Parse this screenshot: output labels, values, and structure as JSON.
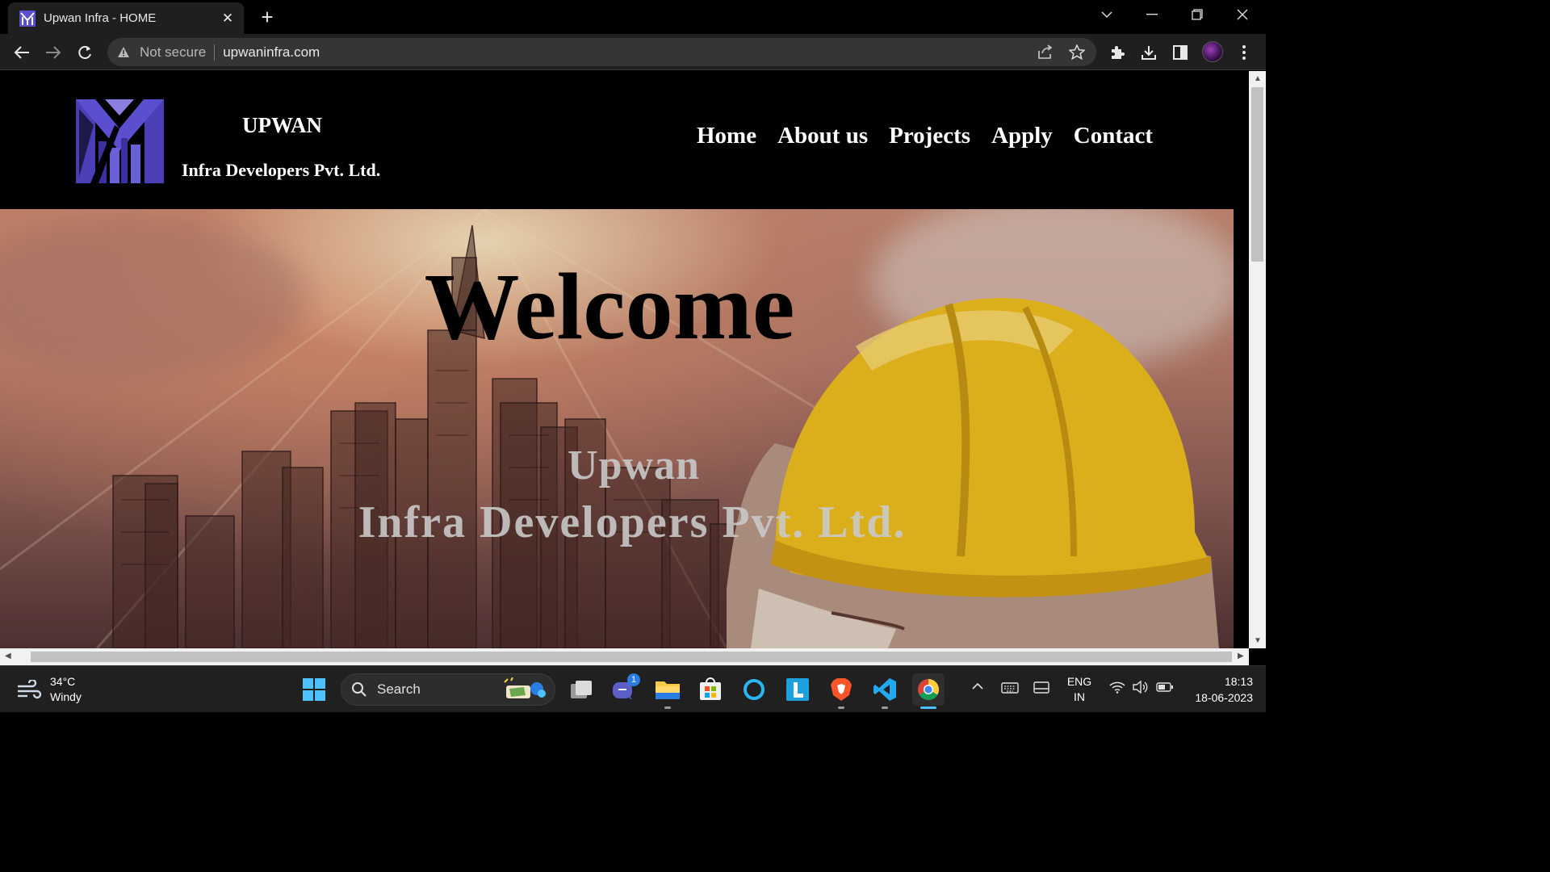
{
  "browser": {
    "tab_title": "Upwan Infra - HOME",
    "security_label": "Not secure",
    "url": "upwaninfra.com"
  },
  "site": {
    "brand_name": "UPWAN",
    "brand_subtitle": "Infra Developers Pvt. Ltd.",
    "nav": [
      "Home",
      "About us",
      "Projects",
      "Apply",
      "Contact"
    ],
    "hero": {
      "heading": "Welcome",
      "line1": "Upwan",
      "line2": "Infra Developers Pvt. Ltd."
    }
  },
  "taskbar": {
    "weather_temp": "34°C",
    "weather_desc": "Windy",
    "search_label": "Search",
    "teams_badge": "1",
    "lang_line1": "ENG",
    "lang_line2": "IN",
    "time": "18:13",
    "date": "18-06-2023"
  },
  "colors": {
    "accent_purple": "#5a4fcf",
    "helmet_yellow": "#f2c21b",
    "chrome_dark": "#1f1f1f"
  }
}
